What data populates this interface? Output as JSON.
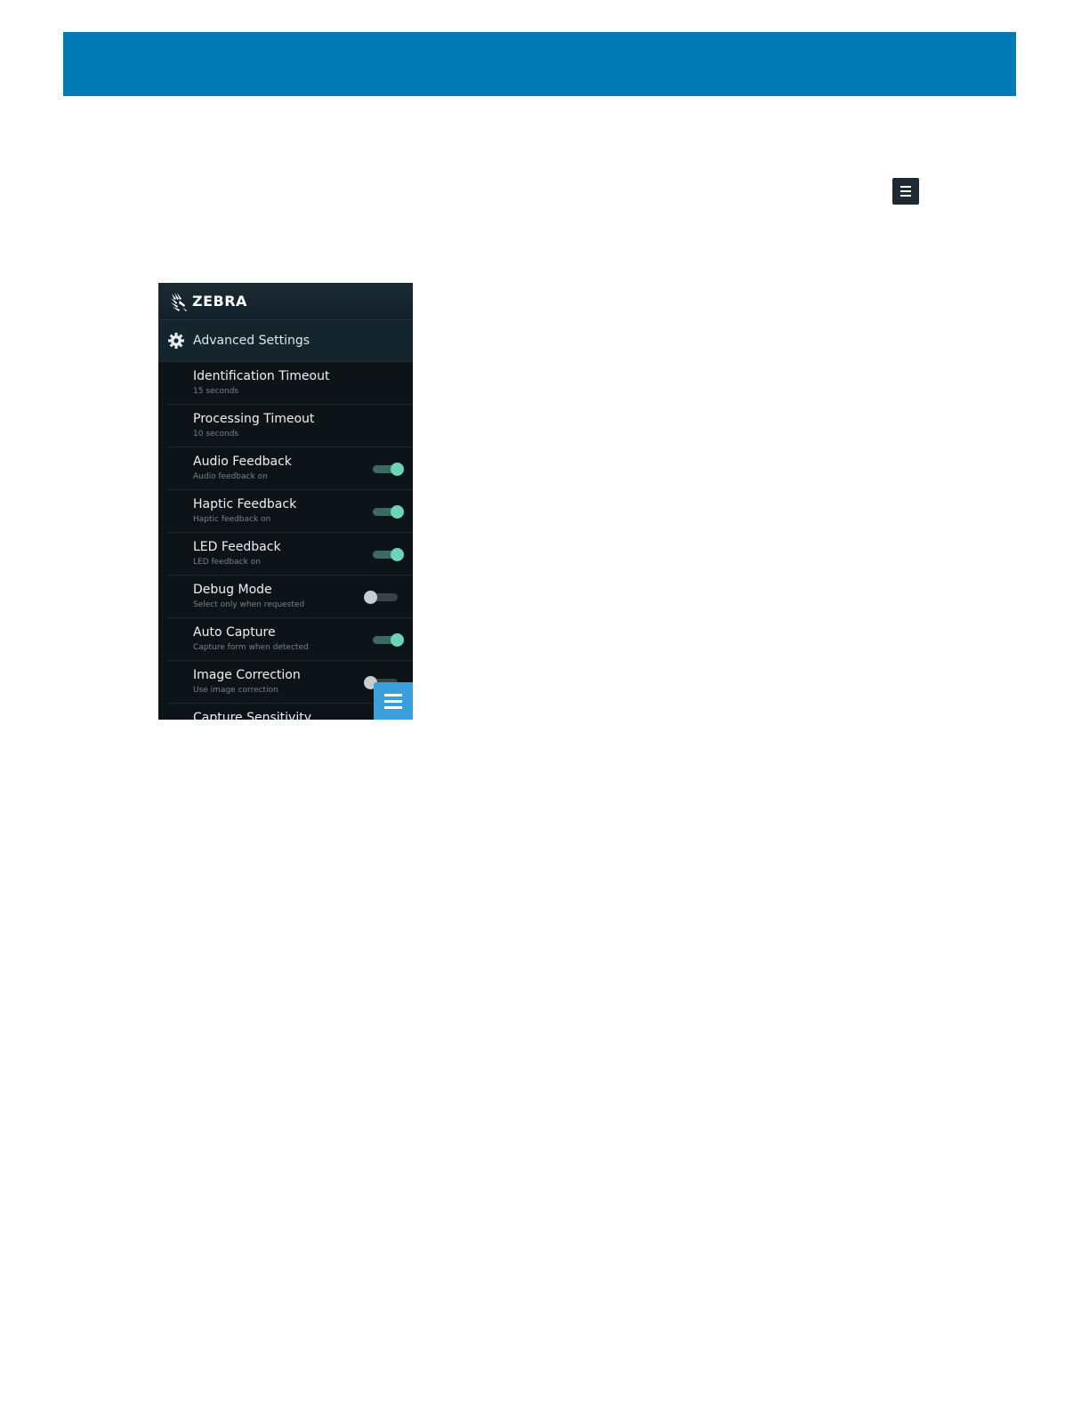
{
  "brand": {
    "name": "ZEBRA",
    "header_color": "#007bb6"
  },
  "app": {
    "section_title": "Advanced Settings",
    "settings": [
      {
        "title": "Identification Timeout",
        "subtitle": "15 seconds",
        "toggle": null
      },
      {
        "title": "Processing Timeout",
        "subtitle": "10 seconds",
        "toggle": null
      },
      {
        "title": "Audio Feedback",
        "subtitle": "Audio feedback on",
        "toggle": "on"
      },
      {
        "title": "Haptic Feedback",
        "subtitle": "Haptic feedback on",
        "toggle": "on"
      },
      {
        "title": "LED Feedback",
        "subtitle": "LED feedback on",
        "toggle": "on"
      },
      {
        "title": "Debug Mode",
        "subtitle": "Select only when requested",
        "toggle": "off"
      },
      {
        "title": "Auto Capture",
        "subtitle": "Capture form when detected",
        "toggle": "on"
      },
      {
        "title": "Image Correction",
        "subtitle": "Use image correction",
        "toggle": "off"
      },
      {
        "title": "Capture Sensitivity",
        "subtitle": "",
        "toggle": null
      }
    ]
  },
  "icons": {
    "menu": "menu-icon",
    "gear": "gear-icon",
    "logo": "zebra-logo-icon"
  },
  "colors": {
    "accent_on": "#6fd3bb",
    "fab": "#3aa0dc",
    "screen_bg": "#0c1418"
  }
}
